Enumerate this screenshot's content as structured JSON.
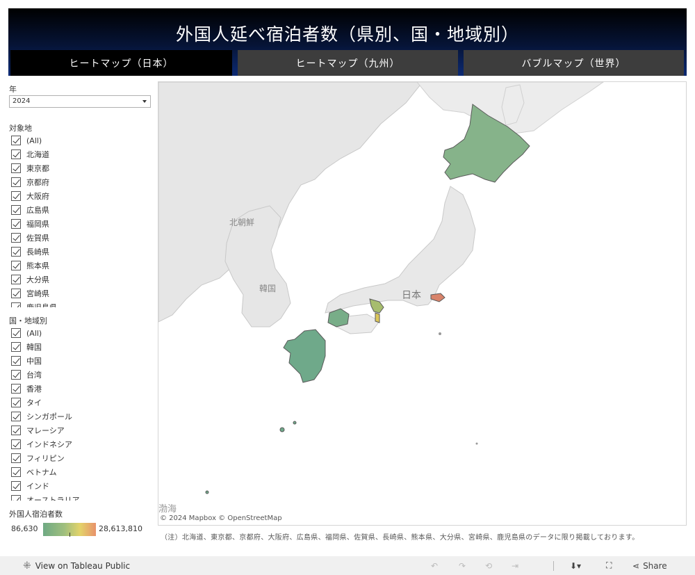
{
  "header": {
    "title": "外国人延べ宿泊者数（県別、国・地域別）",
    "tabs": [
      {
        "label": "ヒートマップ（日本）",
        "active": true
      },
      {
        "label": "ヒートマップ（九州）",
        "active": false
      },
      {
        "label": "バブルマップ（世界）",
        "active": false
      }
    ]
  },
  "filters": {
    "year": {
      "label": "年",
      "value": "2024"
    },
    "region": {
      "label": "対象地",
      "items": [
        "(All)",
        "北海道",
        "東京都",
        "京都府",
        "大阪府",
        "広島県",
        "福岡県",
        "佐賀県",
        "長崎県",
        "熊本県",
        "大分県",
        "宮崎県",
        "鹿児島県"
      ]
    },
    "country": {
      "label": "国・地域別",
      "items": [
        "(All)",
        "韓国",
        "中国",
        "台湾",
        "香港",
        "タイ",
        "シンガポール",
        "マレーシア",
        "インドネシア",
        "フィリピン",
        "ベトナム",
        "インド",
        "オーストラリア"
      ]
    }
  },
  "legend": {
    "label": "外国人宿泊者数",
    "min": "86,630",
    "max": "28,613,810",
    "colors": [
      "#6faa84",
      "#9fbf7e",
      "#e3d36a",
      "#e8926b"
    ]
  },
  "map": {
    "labels": {
      "north_korea": "北朝鮮",
      "south_korea": "韓国",
      "japan": "日本",
      "sea": "渤海"
    },
    "attribution": "© 2024 Mapbox  © OpenStreetMap",
    "colors": {
      "hokkaido": "#86b38a",
      "kyushu": "#6fa98a",
      "hiroshima": "#78ad88",
      "kyoto": "#a7bd6e",
      "osaka": "#dcc75a",
      "tokyo": "#d8836a"
    }
  },
  "note": "（注）北海道、東京都、京都府、大阪府、広島県、福岡県、佐賀県、長崎県、熊本県、大分県、宮崎県、鹿児島県のデータに限り掲載しております。",
  "footer": {
    "view_label": "View on Tableau Public",
    "share_label": "Share"
  }
}
